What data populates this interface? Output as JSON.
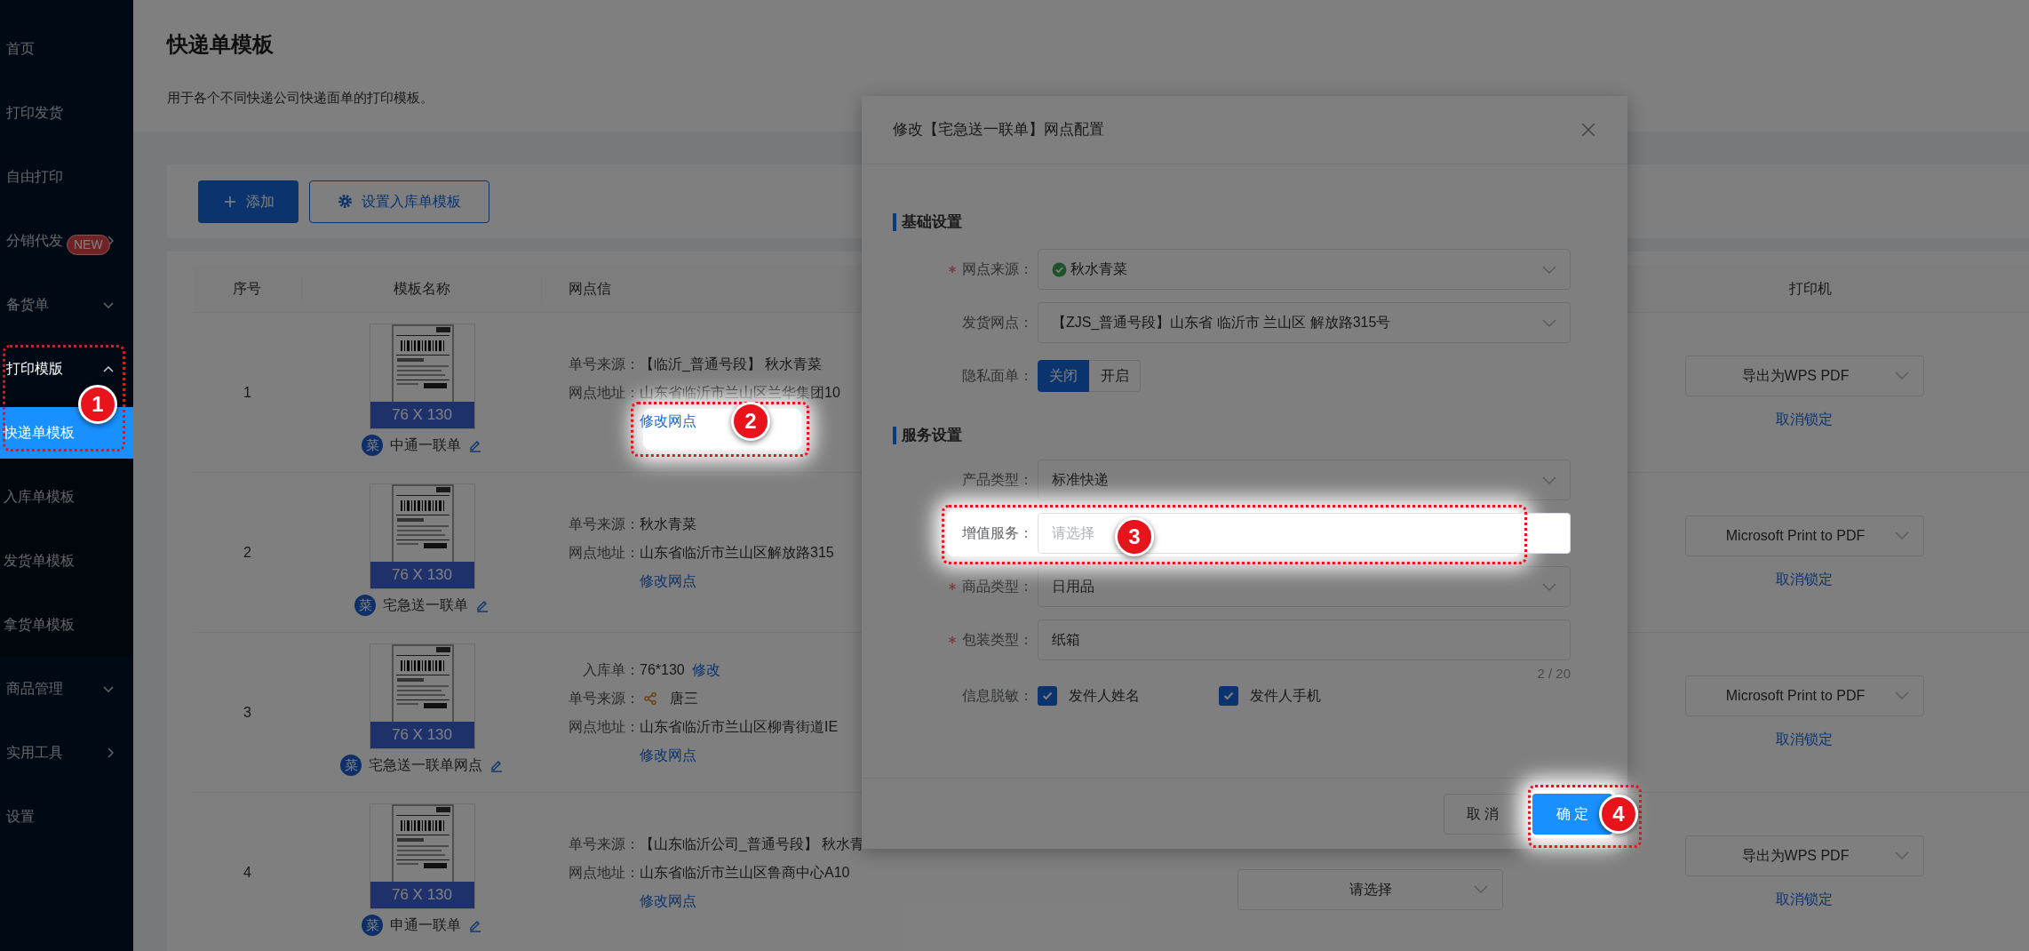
{
  "sidebar": {
    "items": [
      {
        "label": "首页",
        "kind": "link",
        "selected": false
      },
      {
        "label": "打印发货",
        "kind": "link",
        "selected": false
      },
      {
        "label": "自由打印",
        "kind": "link",
        "selected": false
      },
      {
        "label": "分销代发",
        "kind": "flyout",
        "selected": false,
        "badge": "NEW"
      },
      {
        "label": "备货单",
        "kind": "group",
        "expanded": false,
        "selected": false
      },
      {
        "label": "打印模版",
        "kind": "group",
        "expanded": true,
        "selected": false,
        "callout": "1",
        "children": [
          {
            "label": "快递单模板",
            "selected": true
          },
          {
            "label": "入库单模板",
            "selected": false
          },
          {
            "label": "发货单模板",
            "selected": false
          },
          {
            "label": "拿货单模板",
            "selected": false
          }
        ]
      },
      {
        "label": "商品管理",
        "kind": "group",
        "expanded": false,
        "selected": false
      },
      {
        "label": "实用工具",
        "kind": "flyout",
        "selected": false
      },
      {
        "label": "设置",
        "kind": "link",
        "selected": false
      }
    ]
  },
  "page": {
    "title": "快递单模板",
    "subtitle": "用于各个不同快递公司快递面单的打印模板。"
  },
  "toolbar": {
    "buttons": [
      {
        "label": "添加",
        "kind": "primary"
      },
      {
        "label": "设置入库单模板",
        "kind": "outline"
      }
    ]
  },
  "table": {
    "columns": [
      "序号",
      "模板名称",
      "网点信",
      "打印机"
    ],
    "rows": [
      {
        "index": "1",
        "size": "76 X 130",
        "logo": "菜",
        "name": "中通一联单",
        "info": [
          {
            "kind": "text",
            "label": "单号来源：",
            "value": "【临沂_普通号段】 秋水青菜"
          },
          {
            "kind": "text",
            "label": "网点地址：",
            "value": "山东省临沂市兰山区兰华集团10"
          }
        ],
        "edit_link": "修改网点",
        "edit_callout": "2",
        "printer": "导出为WPS PDF",
        "unlock": "取消锁定"
      },
      {
        "index": "2",
        "size": "76 X 130",
        "logo": "菜",
        "name": "宅急送一联单",
        "info": [
          {
            "kind": "text",
            "label": "单号来源：",
            "value": "秋水青菜"
          },
          {
            "kind": "text",
            "label": "网点地址：",
            "value": "山东省临沂市兰山区解放路315"
          }
        ],
        "edit_link": "修改网点",
        "printer": "Microsoft Print to PDF",
        "unlock": "取消锁定"
      },
      {
        "index": "3",
        "size": "76 X 130",
        "logo": "菜",
        "name": "宅急送一联单网点",
        "info": [
          {
            "kind": "text_link",
            "label": "入库单：",
            "value": "76*130",
            "link": "修改"
          },
          {
            "kind": "shared",
            "label": "单号来源：",
            "value": "唐三"
          },
          {
            "kind": "text",
            "label": "网点地址：",
            "value": "山东省临沂市兰山区柳青街道IE"
          }
        ],
        "edit_link": "修改网点",
        "printer": "Microsoft Print to PDF",
        "unlock": "取消锁定"
      },
      {
        "index": "4",
        "size": "76 X 130",
        "logo": "菜",
        "name": "申通一联单",
        "info": [
          {
            "kind": "text",
            "label": "单号来源：",
            "value": "【山东临沂公司_普通号段】 秋水青"
          },
          {
            "kind": "text",
            "label": "网点地址：",
            "value": "山东省临沂市兰山区鲁商中心A10"
          }
        ],
        "edit_link": "修改网点",
        "column_4_select": "请选择",
        "printer": "导出为WPS PDF",
        "unlock": "取消锁定"
      }
    ]
  },
  "modal": {
    "title": "修改【宅急送一联单】网点配置",
    "sections": [
      {
        "title": "基础设置",
        "fields": [
          {
            "kind": "verified_select",
            "label": "网点来源：",
            "required": true,
            "value": "秋水青菜"
          },
          {
            "kind": "select",
            "label": "发货网点：",
            "required": false,
            "value": "【ZJS_普通号段】山东省 临沂市 兰山区 解放路315号"
          },
          {
            "kind": "segmented",
            "label": "隐私面单：",
            "required": false,
            "options": [
              {
                "label": "关闭",
                "selected": true
              },
              {
                "label": "开启",
                "selected": false
              }
            ]
          }
        ]
      },
      {
        "title": "服务设置",
        "fields": [
          {
            "kind": "select",
            "label": "产品类型：",
            "required": false,
            "value": "标准快递"
          },
          {
            "kind": "input",
            "label": "增值服务：",
            "required": false,
            "placeholder": "请选择",
            "callout": "3"
          },
          {
            "kind": "select",
            "label": "商品类型：",
            "required": true,
            "value": "日用品"
          },
          {
            "kind": "input",
            "label": "包装类型：",
            "required": true,
            "value": "纸箱",
            "counter": "2 / 20"
          },
          {
            "kind": "checkboxes",
            "label": "信息脱敏：",
            "required": false,
            "options": [
              {
                "label": "发件人姓名",
                "checked": true
              },
              {
                "label": "发件人手机",
                "checked": true
              }
            ]
          }
        ]
      }
    ],
    "cancel": "取 消",
    "confirm": "确 定",
    "confirm_callout": "4"
  }
}
